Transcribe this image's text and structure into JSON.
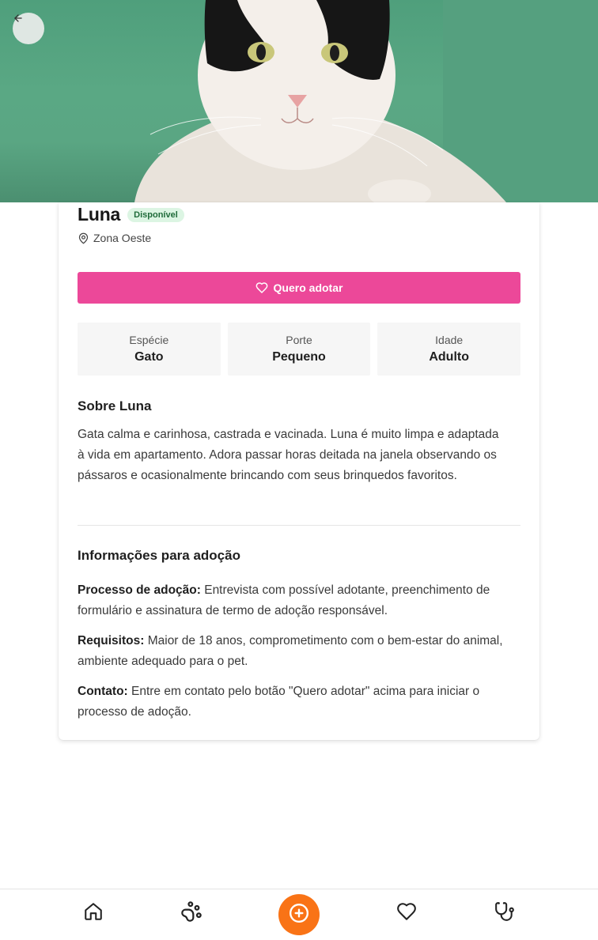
{
  "pet": {
    "name": "Luna",
    "status": "Disponível",
    "location": "Zona Oeste"
  },
  "actions": {
    "adopt_label": "Quero adotar"
  },
  "stats": [
    {
      "label": "Espécie",
      "value": "Gato"
    },
    {
      "label": "Porte",
      "value": "Pequeno"
    },
    {
      "label": "Idade",
      "value": "Adulto"
    }
  ],
  "about": {
    "title": "Sobre Luna",
    "text": "Gata calma e carinhosa, castrada e vacinada. Luna é muito limpa e adaptada à vida em apartamento. Adora passar horas deitada na janela observando os pássaros e ocasionalmente brincando com seus brinquedos favoritos."
  },
  "adoption_info": {
    "title": "Informações para adoção",
    "items": [
      {
        "label": "Processo de adoção:",
        "text": " Entrevista com possível adotante, preenchimento de formulário e assinatura de termo de adoção responsável."
      },
      {
        "label": "Requisitos:",
        "text": " Maior de 18 anos, comprometimento com o bem-estar do animal, ambiente adequado para o pet."
      },
      {
        "label": "Contato:",
        "text": " Entre em contato pelo botão \"Quero adotar\" acima para iniciar o processo de adoção."
      }
    ]
  },
  "nav": {
    "items": [
      "home-icon",
      "paw-icon",
      "add-icon",
      "heart-icon",
      "stethoscope-icon"
    ]
  },
  "colors": {
    "accent_pink": "#ec4899",
    "accent_orange": "#f97316",
    "badge_bg": "#dcf5e3",
    "badge_text": "#1f6b3a"
  }
}
